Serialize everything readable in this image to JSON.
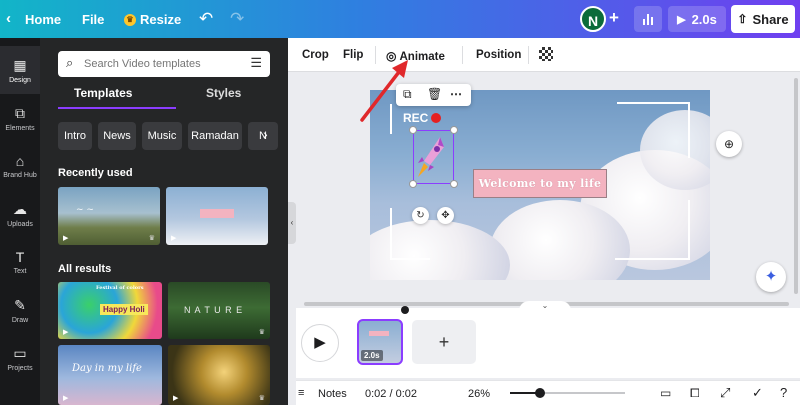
{
  "topbar": {
    "home_label": "Home",
    "file_label": "File",
    "resize_label": "Resize",
    "avatar_initial": "N",
    "play_duration": "2.0s",
    "share_label": "Share"
  },
  "rail": {
    "items": [
      {
        "label": "Design",
        "icon": "design-icon"
      },
      {
        "label": "Elements",
        "icon": "elements-icon"
      },
      {
        "label": "Brand Hub",
        "icon": "brand-hub-icon"
      },
      {
        "label": "Uploads",
        "icon": "uploads-icon"
      },
      {
        "label": "Text",
        "icon": "text-icon"
      },
      {
        "label": "Draw",
        "icon": "draw-icon"
      },
      {
        "label": "Projects",
        "icon": "projects-icon"
      }
    ]
  },
  "panel": {
    "search_placeholder": "Search Video templates",
    "tabs": [
      "Templates",
      "Styles"
    ],
    "chips": [
      "Intro",
      "News",
      "Music",
      "Ramadan",
      "N"
    ],
    "recently_used_title": "Recently used",
    "all_results_title": "All results",
    "thumb_texts": {
      "holi_top": "Festival of colors",
      "holi_main": "Happy Holi",
      "nature": "N A T U R E",
      "day": "Day in my life"
    }
  },
  "context_toolbar": {
    "crop": "Crop",
    "flip": "Flip",
    "animate": "Animate",
    "position": "Position"
  },
  "canvas": {
    "rec_label": "REC",
    "welcome_text": "Welcome to my life"
  },
  "timeline": {
    "clip_duration": "2.0s",
    "add_label": "+"
  },
  "bottom": {
    "notes_label": "Notes",
    "time": "0:02 / 0:02",
    "zoom": "26%",
    "zoom_fraction": 0.26
  },
  "colors": {
    "accent": "#8b3dff",
    "record_red": "#e52020",
    "arrow_red": "#e0282b"
  }
}
